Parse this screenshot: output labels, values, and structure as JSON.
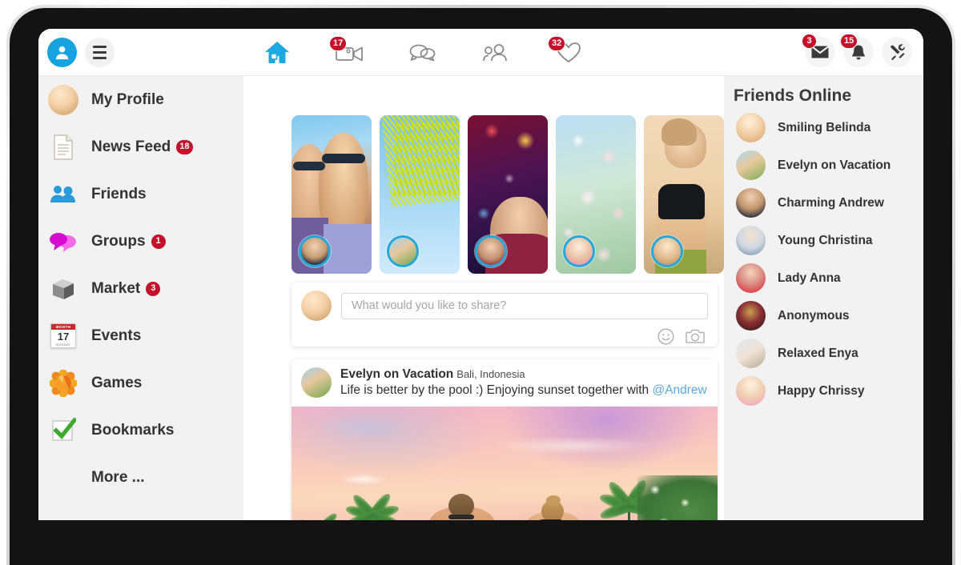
{
  "topbar": {
    "profile_icon": "user-avatar-icon",
    "menu_icon": "hamburger-menu-icon",
    "nav": [
      {
        "name": "home",
        "icon": "home-icon",
        "badge": "",
        "active": true
      },
      {
        "name": "video",
        "icon": "video-camera-icon",
        "badge": "17"
      },
      {
        "name": "messages",
        "icon": "chat-bubbles-icon",
        "badge": ""
      },
      {
        "name": "people",
        "icon": "people-icon",
        "badge": ""
      },
      {
        "name": "likes",
        "icon": "heart-icon",
        "badge": "32"
      }
    ],
    "right": [
      {
        "name": "mail",
        "icon": "envelope-icon",
        "badge": "3"
      },
      {
        "name": "notifications",
        "icon": "bell-icon",
        "badge": "15"
      },
      {
        "name": "settings",
        "icon": "tools-icon",
        "badge": ""
      }
    ]
  },
  "sidebar": {
    "items": [
      {
        "label": "My Profile",
        "icon": "profile-photo-avatar",
        "badge": ""
      },
      {
        "label": "News Feed",
        "icon": "document-icon",
        "badge": "18"
      },
      {
        "label": "Friends",
        "icon": "friends-people-icon",
        "badge": ""
      },
      {
        "label": "Groups",
        "icon": "speech-bubbles-icon",
        "badge": "1"
      },
      {
        "label": "Market",
        "icon": "box-icon",
        "badge": "3"
      },
      {
        "label": "Events",
        "icon": "calendar-icon",
        "badge": ""
      },
      {
        "label": "Games",
        "icon": "flower-burst-icon",
        "badge": ""
      },
      {
        "label": "Bookmarks",
        "icon": "green-checkmark-icon",
        "badge": ""
      },
      {
        "label": "More ...",
        "icon": "",
        "badge": ""
      }
    ],
    "calendar": {
      "month": "MONTH",
      "day": "17",
      "weekday": "MONDAY"
    }
  },
  "stories": [
    {
      "name": "couple-selfie-story",
      "avatar": "andrew-avatar"
    },
    {
      "name": "palm-leaf-story",
      "avatar": "evelyn-avatar"
    },
    {
      "name": "bokeh-lights-story",
      "avatar": "anna-avatar"
    },
    {
      "name": "cherry-blossom-story",
      "avatar": "chrissy-avatar"
    },
    {
      "name": "beach-workout-story",
      "avatar": "belinda-avatar"
    }
  ],
  "composer": {
    "placeholder": "What would you like to share?",
    "value": "",
    "emoji_icon": "smiley-face-icon",
    "photo_icon": "camera-icon"
  },
  "post": {
    "author": "Evelyn on Vacation",
    "location": "Bali, Indonesia",
    "text": "Life is better by the pool :) Enjoying sunset together with ",
    "mention": "@Andrew",
    "photo_name": "sunset-pool-palm-trees-photo"
  },
  "friends_online": {
    "title": "Friends Online",
    "items": [
      {
        "name": "Smiling Belinda"
      },
      {
        "name": "Evelyn on Vacation"
      },
      {
        "name": "Charming Andrew"
      },
      {
        "name": "Young Christina"
      },
      {
        "name": "Lady Anna"
      },
      {
        "name": "Anonymous"
      },
      {
        "name": "Relaxed Enya"
      },
      {
        "name": "Happy Chrissy"
      }
    ]
  },
  "colors": {
    "accent_blue": "#17A3E0",
    "badge_red": "#C4102B",
    "sidebar_bg": "#F2F2F2",
    "mention_blue": "#5FA8DD",
    "text_dark": "#333333"
  }
}
